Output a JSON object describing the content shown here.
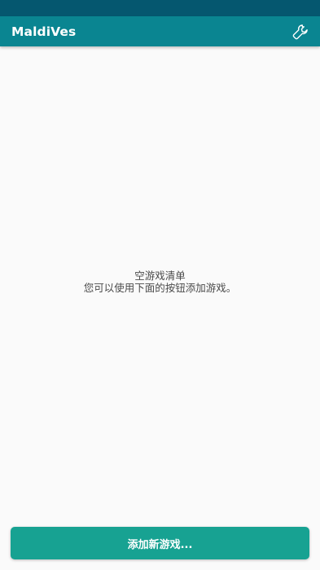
{
  "app_bar": {
    "title": "MaldiVes",
    "settings_icon": "wrench-icon"
  },
  "empty_state": {
    "title": "空游戏清单",
    "message": "您可以使用下面的按钮添加游戏。"
  },
  "actions": {
    "add_game_label": "添加新游戏..."
  },
  "colors": {
    "status_bar": "#05576f",
    "app_bar": "#0a8591",
    "accent_button": "#17a292",
    "background": "#fafafa"
  }
}
